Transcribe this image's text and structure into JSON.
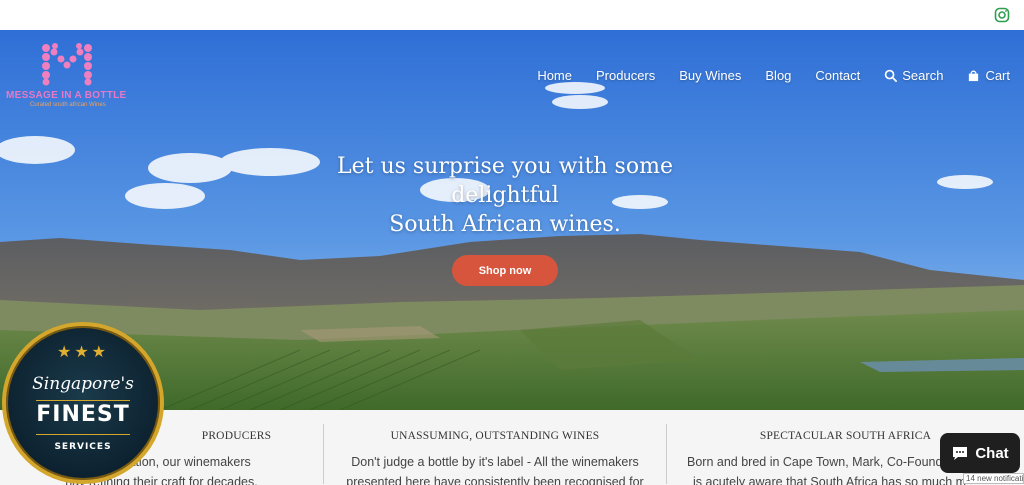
{
  "brand": {
    "logo_letter": "M",
    "name": "MESSAGE IN A BOTTLE",
    "tagline": "Curated south african Wines"
  },
  "nav": {
    "items": [
      {
        "label": "Home",
        "icon": ""
      },
      {
        "label": "Producers",
        "icon": ""
      },
      {
        "label": "Buy Wines",
        "icon": ""
      },
      {
        "label": "Blog",
        "icon": ""
      },
      {
        "label": "Contact",
        "icon": ""
      },
      {
        "label": "Search",
        "icon": "search-icon"
      },
      {
        "label": "Cart",
        "icon": "bag-icon"
      }
    ]
  },
  "hero": {
    "headline_line1": "Let us surprise you with some",
    "headline_line2": "delightful",
    "headline_line3": "South African wines.",
    "cta_label": "Shop now"
  },
  "features": [
    {
      "title": "PRODUCERS",
      "text_line1": "Fi            n generation, our winemakers",
      "text_line2": "hav        refining their craft for decades."
    },
    {
      "title": "UNASSUMING, OUTSTANDING WINES",
      "text_line1": "Don't judge a bottle by it's label - All the winemakers",
      "text_line2": "presented here have consistently been recognised for"
    },
    {
      "title": "SPECTACULAR SOUTH AFRICA",
      "text_line1": "Born and bred in Cape Town, Mark, Co-Found",
      "text_line2": "is acutely aware that South Africa has so much m"
    }
  ],
  "badge": {
    "line1": "Singapore's",
    "line2": "FINEST",
    "line3": "SERVICES"
  },
  "chat": {
    "label": "Chat"
  },
  "notification": {
    "text": "14 new notificati"
  },
  "colors": {
    "cta": "#d6553c",
    "sky_top": "#2f6fd6",
    "sky_bottom": "#8fc0ee",
    "badge_gold": "#d4a72c",
    "instagram": "#2e9e4f"
  }
}
